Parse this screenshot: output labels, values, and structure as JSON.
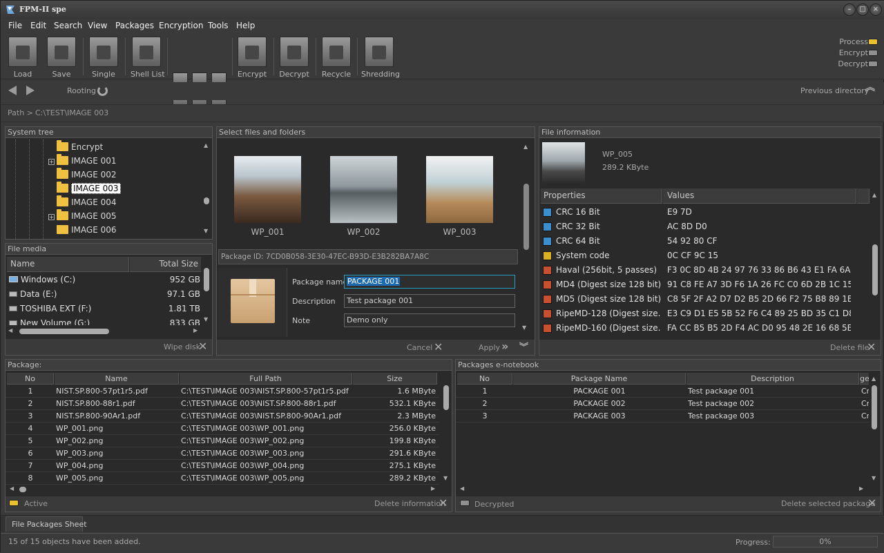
{
  "app": {
    "title": "FPM-II spe"
  },
  "menu": [
    "File",
    "Edit",
    "Search",
    "View",
    "Packages",
    "Encryption",
    "Tools",
    "Help"
  ],
  "toolbar": {
    "load": "Load",
    "save": "Save",
    "single": "Single",
    "shell_list": "Shell List",
    "encrypt": "Encrypt",
    "decrypt": "Decrypt",
    "recycle": "Recycle",
    "shredding": "Shredding"
  },
  "status_lamps": {
    "process": "Process",
    "encrypt": "Encrypt",
    "decrypt": "Decrypt"
  },
  "nav": {
    "rooting": "Rooting",
    "previous_directory": "Previous directory"
  },
  "path": {
    "label": "Path >",
    "value": "C:\\TEST\\IMAGE 003"
  },
  "system_tree": {
    "title": "System tree",
    "items": [
      {
        "label": "Encrypt",
        "expandable": false
      },
      {
        "label": "IMAGE 001",
        "expandable": true
      },
      {
        "label": "IMAGE 002",
        "expandable": false
      },
      {
        "label": "IMAGE 003",
        "expandable": false,
        "selected": true
      },
      {
        "label": "IMAGE 004",
        "expandable": false
      },
      {
        "label": "IMAGE 005",
        "expandable": true
      },
      {
        "label": "IMAGE 006",
        "expandable": false
      }
    ]
  },
  "file_media": {
    "title": "File media",
    "col_name": "Name",
    "col_size": "Total Size",
    "rows": [
      {
        "name": "Windows  (C:)",
        "size": "952 GB"
      },
      {
        "name": "Data (E:)",
        "size": "97.1 GB"
      },
      {
        "name": "TOSHIBA EXT (F:)",
        "size": "1.81 TB"
      },
      {
        "name": "New Volume (G:)",
        "size": "833 GB"
      }
    ],
    "wipe_disk": "Wipe disk"
  },
  "select_files": {
    "title": "Select files and folders",
    "thumbs": [
      "WP_001",
      "WP_002",
      "WP_003"
    ],
    "package_id": "Package ID: 7CD0B058-3E30-47EC-B93D-E3B282BA7A8C",
    "package_name_label": "Package name",
    "package_name_value": "PACKAGE  001",
    "description_label": "Description",
    "description_value": "Test package 001",
    "note_label": "Note",
    "note_value": "Demo only",
    "cancel": "Cancel",
    "apply": "Apply"
  },
  "file_info": {
    "title": "File information",
    "name": "WP_005",
    "size": "289.2 KByte",
    "col_props": "Properties",
    "col_values": "Values",
    "rows": [
      {
        "prop": "CRC 16 Bit",
        "value": "E9 7D",
        "icon_color": "#3a8fd0"
      },
      {
        "prop": "CRC 32 Bit",
        "value": "AC 8D D0",
        "icon_color": "#3a8fd0"
      },
      {
        "prop": "CRC 64 Bit",
        "value": "54 92 80 CF",
        "icon_color": "#3a8fd0"
      },
      {
        "prop": "System code",
        "value": "0C CF 9C 15",
        "icon_color": "#d8b020"
      },
      {
        "prop": "Haval (256bit, 5 passes)",
        "value": "F3 0C 8D 4B 24 97 76 33 86 B6 43 E1 FA 6A ...",
        "icon_color": "#c85030"
      },
      {
        "prop": "MD4 (Digest size 128 bit)",
        "value": "91 C8 FE A7 3D F6 1A 26 FC C0 6D 2B 1C 15...",
        "icon_color": "#c85030"
      },
      {
        "prop": "MD5 (Digest size 128 bit)",
        "value": "C8 5F 2F A2 D7 D2 B5 2D 66 F2 75 B8 89 1B ...",
        "icon_color": "#c85030"
      },
      {
        "prop": "RipeMD-128 (Digest size...",
        "value": "E3 C9 D1 E5 5B 52 F6 C4 89 25 BD 35 C1 D8...",
        "icon_color": "#c85030"
      },
      {
        "prop": "RipeMD-160 (Digest size...",
        "value": "FA CC B5 B5 2D F4 AC D0 95 48 2E 16 68 5E ...",
        "icon_color": "#c85030"
      }
    ],
    "delete_file": "Delete file"
  },
  "package": {
    "title": "Package:",
    "cols": [
      "No",
      "Name",
      "Full Path",
      "Size"
    ],
    "rows": [
      [
        "1",
        "NIST.SP.800-57pt1r5.pdf",
        "C:\\TEST\\IMAGE 003\\NIST.SP.800-57pt1r5.pdf",
        "1.6 MByte"
      ],
      [
        "2",
        "NIST.SP.800-88r1.pdf",
        "C:\\TEST\\IMAGE 003\\NIST.SP.800-88r1.pdf",
        "532.1 KByte"
      ],
      [
        "3",
        "NIST.SP.800-90Ar1.pdf",
        "C:\\TEST\\IMAGE 003\\NIST.SP.800-90Ar1.pdf",
        "2.3 MByte"
      ],
      [
        "4",
        "WP_001.png",
        "C:\\TEST\\IMAGE 003\\WP_001.png",
        "256.0 KByte"
      ],
      [
        "5",
        "WP_002.png",
        "C:\\TEST\\IMAGE 003\\WP_002.png",
        "199.8 KByte"
      ],
      [
        "6",
        "WP_003.png",
        "C:\\TEST\\IMAGE 003\\WP_003.png",
        "291.6 KByte"
      ],
      [
        "7",
        "WP_004.png",
        "C:\\TEST\\IMAGE 003\\WP_004.png",
        "275.1 KByte"
      ],
      [
        "8",
        "WP_005.png",
        "C:\\TEST\\IMAGE 003\\WP_005.png",
        "289.2 KByte"
      ]
    ],
    "active": "Active",
    "delete_information": "Delete information"
  },
  "notebook": {
    "title": "Packages e-notebook",
    "cols": [
      "No",
      "Package Name",
      "Description",
      "ge:"
    ],
    "rows": [
      [
        "1",
        "PACKAGE  001",
        "Test package 001",
        "Cr"
      ],
      [
        "2",
        "PACKAGE 002",
        "Test package 002",
        "Cr"
      ],
      [
        "3",
        "PACKAGE 003",
        "Test package 003",
        "Cr"
      ]
    ],
    "decrypted": "Decrypted",
    "delete_selected_package": "Delete selected package"
  },
  "tabs": {
    "file_packages_sheet": "File Packages Sheet"
  },
  "status": {
    "message": "15 of 15 objects have been added.",
    "progress_label": "Progress:",
    "progress_value": "0%",
    "progress": 0
  }
}
